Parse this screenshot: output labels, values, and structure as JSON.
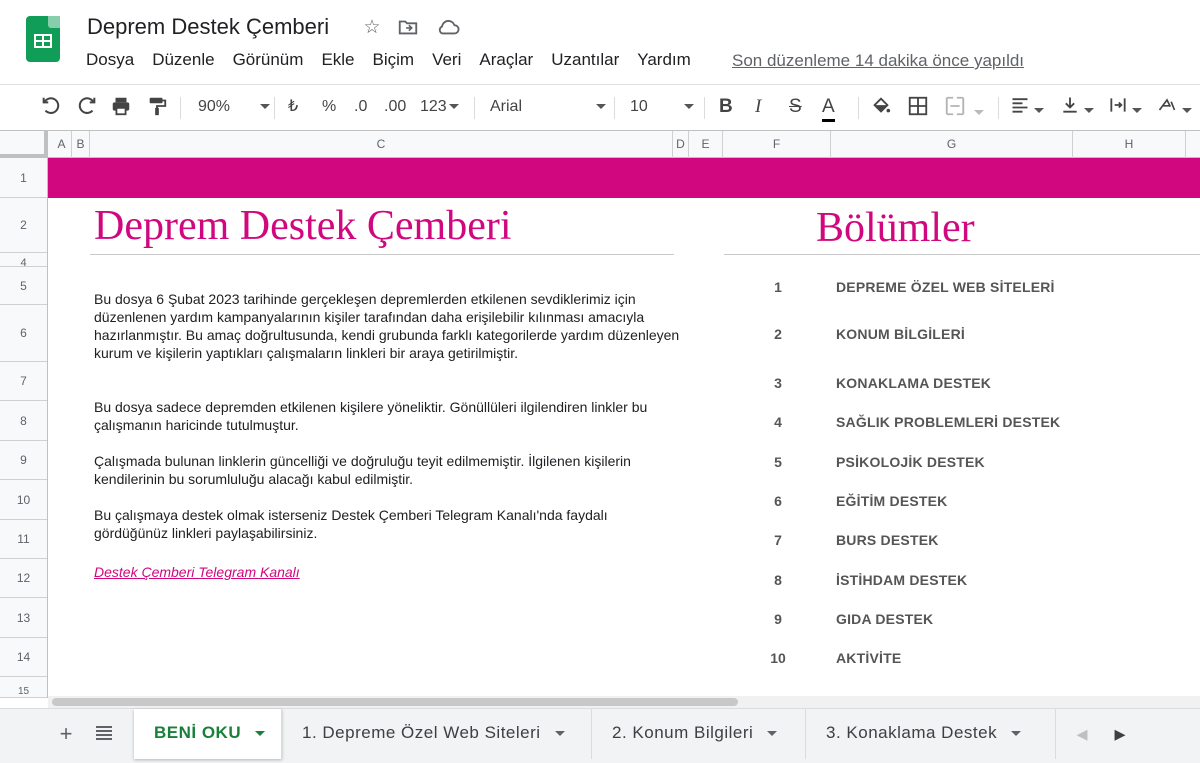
{
  "app": {
    "doc_title": "Deprem Destek Çemberi",
    "last_edit": "Son düzenleme 14 dakika önce yapıldı"
  },
  "menu": [
    "Dosya",
    "Düzenle",
    "Görünüm",
    "Ekle",
    "Biçim",
    "Veri",
    "Araçlar",
    "Uzantılar",
    "Yardım"
  ],
  "toolbar": {
    "zoom": "90%",
    "currency": "₺",
    "percent": "%",
    "decrease_decimal": ".0",
    "increase_decimal": ".00",
    "more_formats": "123",
    "font": "Arial",
    "font_size": "10",
    "bold": "B",
    "italic": "I",
    "strike": "S",
    "text_color": "A"
  },
  "columns": [
    "A",
    "B",
    "C",
    "D",
    "E",
    "F",
    "G",
    "H"
  ],
  "rows": [
    "1",
    "2",
    "4",
    "5",
    "6",
    "7",
    "8",
    "9",
    "10",
    "11",
    "12",
    "13",
    "14",
    "15"
  ],
  "content": {
    "left_heading": "Deprem Destek Çemberi",
    "right_heading": "Bölümler",
    "paragraphs": [
      "Bu dosya 6 Şubat 2023 tarihinde gerçekleşen depremlerden etkilenen sevdiklerimiz için düzenlenen yardım kampanyalarının kişiler tarafından daha erişilebilir kılınması amacıyla hazırlanmıştır. Bu amaç doğrultusunda, kendi grubunda farklı kategorilerde yardım düzenleyen kurum ve kişilerin yaptıkları çalışmaların linkleri bir araya getirilmiştir.",
      "Bu dosya sadece depremden etkilenen kişilere yöneliktir. Gönüllüleri ilgilendiren linkler bu çalışmanın haricinde tutulmuştur.",
      "Çalışmada bulunan linklerin güncelliği ve doğruluğu teyit edilmemiştir. İlgilenen kişilerin kendilerinin bu sorumluluğu alacağı kabul edilmiştir.",
      "Bu çalışmaya destek olmak isterseniz Destek Çemberi Telegram Kanalı'nda faydalı gördüğünüz linkleri paylaşabilirsiniz."
    ],
    "telegram_link": "Destek Çemberi Telegram Kanalı",
    "sections": [
      {
        "num": "1",
        "label": "DEPREME ÖZEL WEB SİTELERİ"
      },
      {
        "num": "2",
        "label": "KONUM BİLGİLERİ"
      },
      {
        "num": "3",
        "label": "KONAKLAMA DESTEK"
      },
      {
        "num": "4",
        "label": "SAĞLIK PROBLEMLERİ DESTEK"
      },
      {
        "num": "5",
        "label": "PSİKOLOJİK DESTEK"
      },
      {
        "num": "6",
        "label": "EĞİTİM DESTEK"
      },
      {
        "num": "7",
        "label": "BURS DESTEK"
      },
      {
        "num": "8",
        "label": "İSTİHDAM DESTEK"
      },
      {
        "num": "9",
        "label": "GIDA DESTEK"
      },
      {
        "num": "10",
        "label": "AKTİVİTE"
      }
    ]
  },
  "sheet_tabs": [
    "BENİ OKU",
    "1. Depreme Özel Web Siteleri",
    "2. Konum Bilgileri",
    "3. Konaklama Destek"
  ],
  "colors": {
    "accent": "#d1077f",
    "active_tab": "#188038"
  }
}
